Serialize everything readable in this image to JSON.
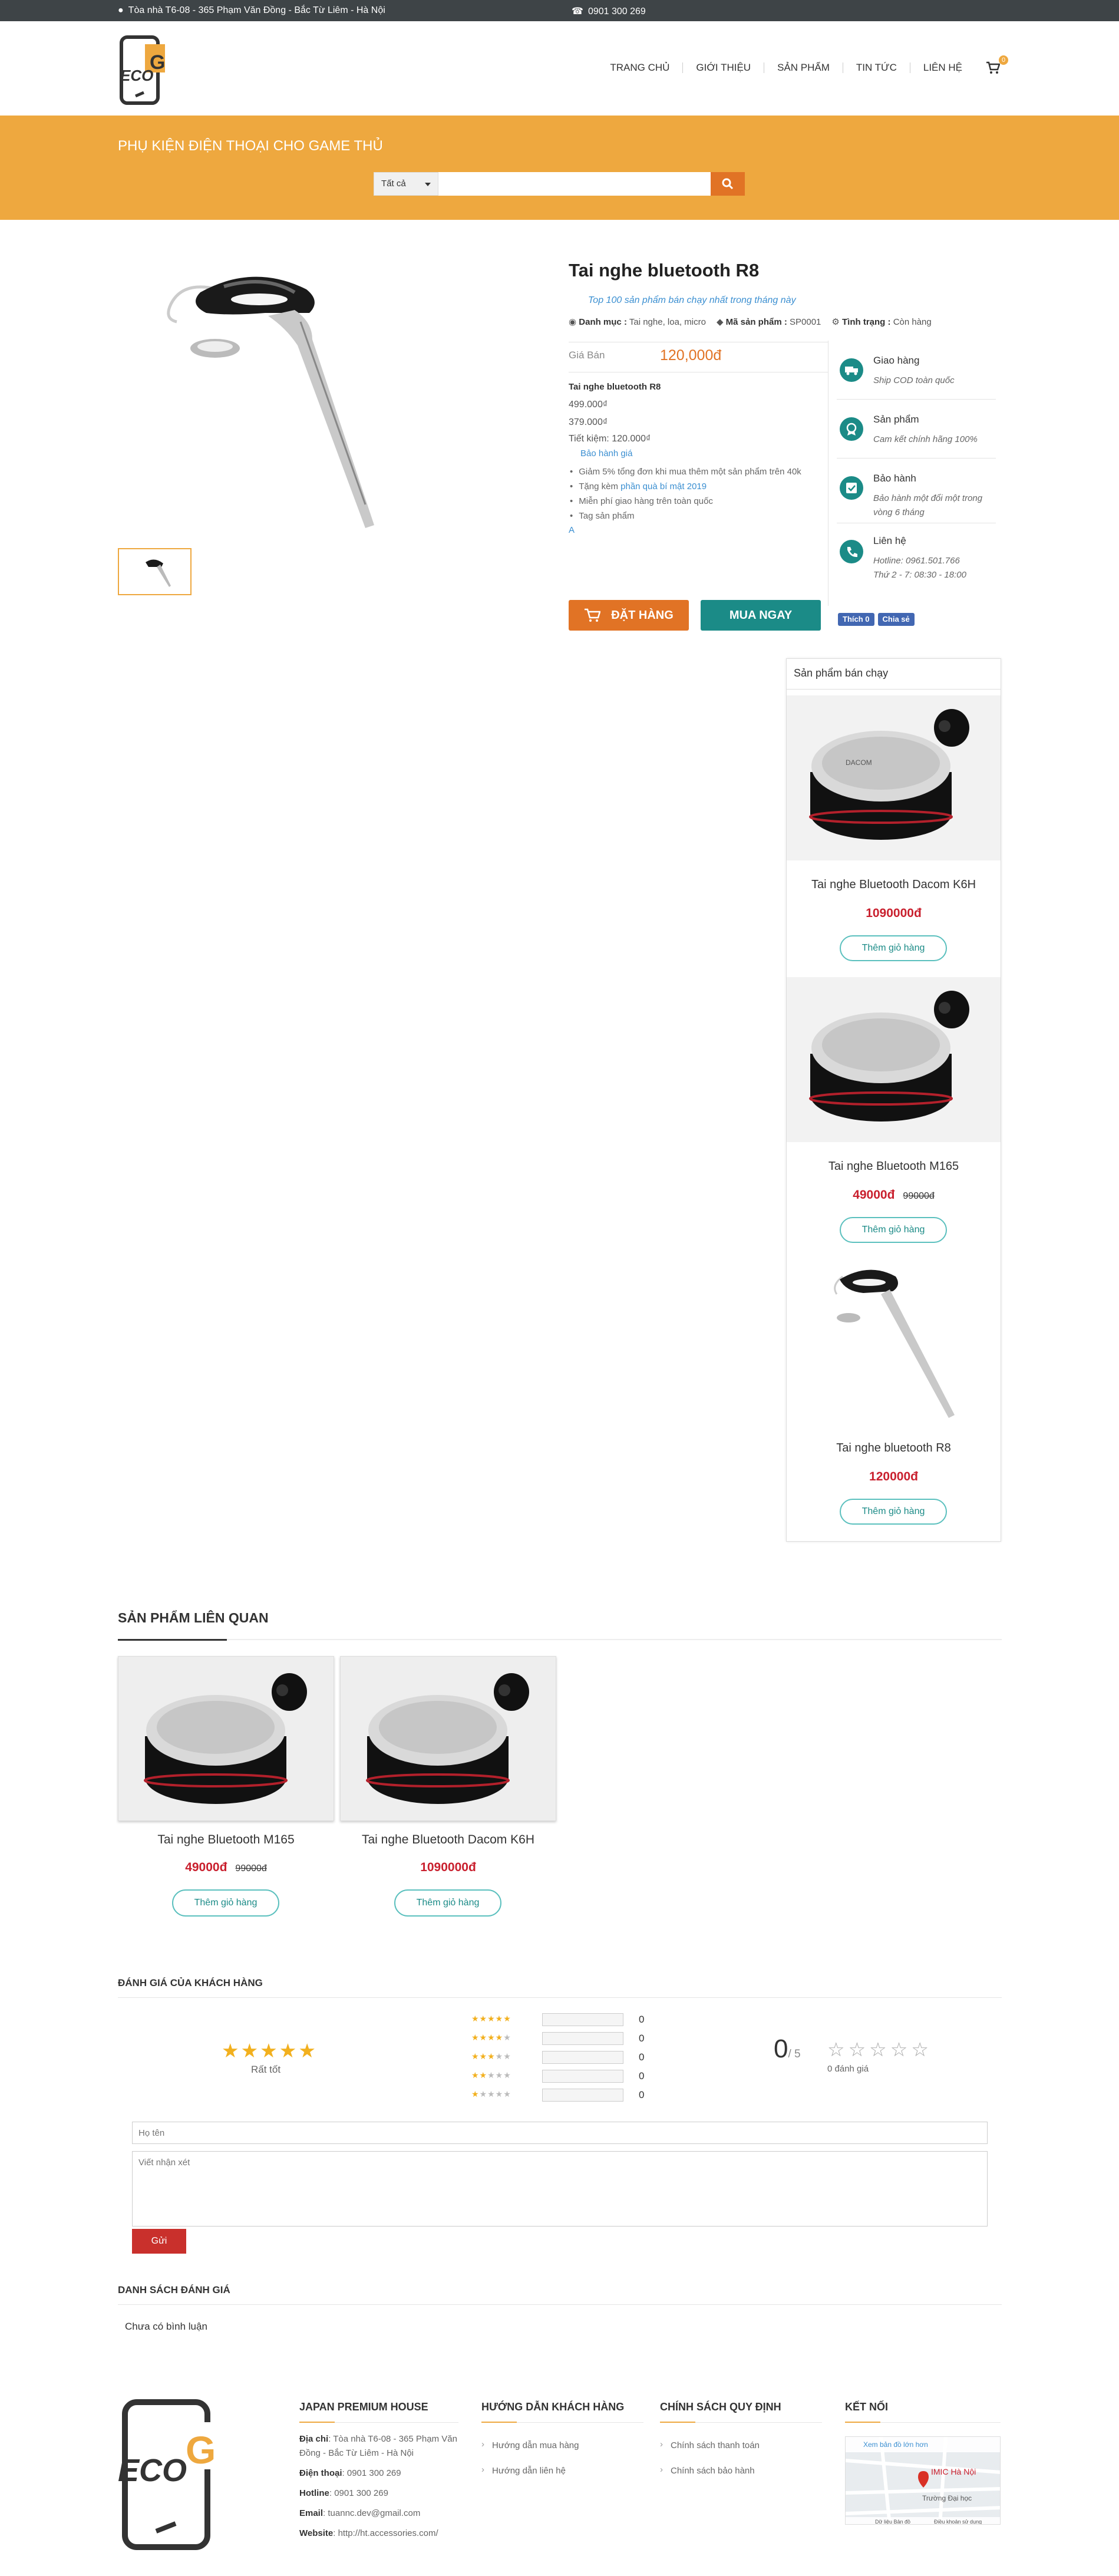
{
  "topbar": {
    "address": "Tòa nhà T6-08 - 365 Phạm Văn Đồng - Bắc Từ Liêm - Hà Nội",
    "phone": "0901 300 269"
  },
  "header": {
    "logo_text": "ECO",
    "logo_letter": "G",
    "nav": [
      "TRANG CHỦ",
      "GIỚI THIỆU",
      "SẢN PHẨM",
      "TIN TỨC",
      "LIÊN HỆ"
    ],
    "cart_count": "0"
  },
  "banner": {
    "title": "PHỤ KIỆN ĐIỆN THOẠI CHO GAME THỦ",
    "search_category": "Tất cả",
    "search_placeholder": ""
  },
  "product": {
    "title": "Tai nghe bluetooth R8",
    "top100": "Top 100 sản phẩm bán chạy nhất trong tháng này",
    "category_label": "Danh mục :",
    "category": "Tai nghe, loa, micro",
    "code_label": "Mã sản phẩm :",
    "code": "SP0001",
    "status_label": "Tình trạng :",
    "status": "Còn hàng",
    "price_label": "Giá Bán",
    "price": "120,000đ",
    "desc_name": "Tai nghe bluetooth R8",
    "price_list": "499.000₫",
    "price_sale": "379.000₫",
    "saving": "Tiết kiệm: 120.000₫",
    "warranty_link": "Bảo hành giá",
    "promos": [
      "Giảm 5% tổng đơn khi mua thêm một sản phẩm trên 40k",
      "Tặng kèm phần quà bí mật 2019",
      "Miễn phí giao hàng trên toàn quốc",
      "Tag sản phẩm"
    ],
    "promo_gift_link": "phần quà bí mật 2019",
    "promo_gift_prefix": "Tặng kèm ",
    "stray_char": "A",
    "order_btn": "ĐẶT HÀNG",
    "buy_btn": "MUA NGAY",
    "fb_like": "Thích 0",
    "fb_share": "Chia sẻ"
  },
  "services": [
    {
      "title": "Giao hàng",
      "text": "Ship COD toàn quốc"
    },
    {
      "title": "Sản phẩm",
      "text": "Cam kết chính hãng 100%"
    },
    {
      "title": "Bảo hành",
      "text": "Bảo hành một đổi một trong vòng 6 tháng"
    },
    {
      "title": "Liên hệ",
      "text1": "Hotline: 0961.501.766",
      "text2": "Thứ 2 - 7: 08:30 - 18:00"
    }
  ],
  "best_sellers": {
    "title": "Sản phẩm bán chạy",
    "items": [
      {
        "name": "Tai nghe Bluetooth Dacom K6H",
        "price": "1090000đ",
        "old": "",
        "add": "Thêm giỏ hàng"
      },
      {
        "name": "Tai nghe Bluetooth M165",
        "price": "49000đ",
        "old": "99000đ",
        "add": "Thêm giỏ hàng"
      },
      {
        "name": "Tai nghe bluetooth R8",
        "price": "120000đ",
        "old": "",
        "add": "Thêm giỏ hàng"
      }
    ]
  },
  "related": {
    "title": "SẢN PHẨM LIÊN QUAN",
    "items": [
      {
        "name": "Tai nghe Bluetooth M165",
        "price": "49000đ",
        "old": "99000đ",
        "add": "Thêm giỏ hàng"
      },
      {
        "name": "Tai nghe Bluetooth Dacom K6H",
        "price": "1090000đ",
        "old": "",
        "add": "Thêm giỏ hàng"
      }
    ]
  },
  "reviews": {
    "title": "ĐÁNH GIÁ CỦA KHÁCH HÀNG",
    "rating_word": "Rất tốt",
    "counts": [
      "0",
      "0",
      "0",
      "0",
      "0"
    ],
    "score": "0",
    "score_max": "/ 5",
    "review_count": "0 đánh giá",
    "name_placeholder": "Họ tên",
    "msg_placeholder": "Viết nhận xét",
    "send": "Gửi",
    "list_title": "DANH SÁCH ĐÁNH GIÁ",
    "empty": "Chưa có bình luận"
  },
  "footer": {
    "col1": {
      "title": "JAPAN PREMIUM HOUSE",
      "addr_label": "Địa chỉ",
      "addr": "Tòa nhà T6-08 - 365 Phạm Văn Đồng - Bắc Từ Liêm - Hà Nội",
      "tel_label": "Điện thoại",
      "tel": "0901 300 269",
      "hotline_label": "Hotline",
      "hotline": "0901 300 269",
      "email_label": "Email",
      "email": "tuannc.dev@gmail.com",
      "web_label": "Website",
      "web": "http://ht.accessories.com/"
    },
    "col2": {
      "title": "HƯỚNG DẪN KHÁCH HÀNG",
      "links": [
        "Hướng dẫn mua hàng",
        "Hướng dẫn liên hệ"
      ]
    },
    "col3": {
      "title": "CHÍNH SÁCH QUY ĐỊNH",
      "links": [
        "Chính sách thanh toán",
        "Chính sách bảo hành"
      ]
    },
    "col4": {
      "title": "KẾT NỐI",
      "map_link": "Xem bản đồ lớn hơn",
      "map_label1": "IMIC Hà Nội",
      "map_label2": "Trường Đại học",
      "map_footer": "Dữ liệu Bản đồ",
      "map_terms": "Điều khoản sử dụng"
    }
  },
  "colors": {
    "accent": "#eea83f",
    "order": "#e17325",
    "teal": "#1b8b87",
    "price": "#c9202e"
  }
}
